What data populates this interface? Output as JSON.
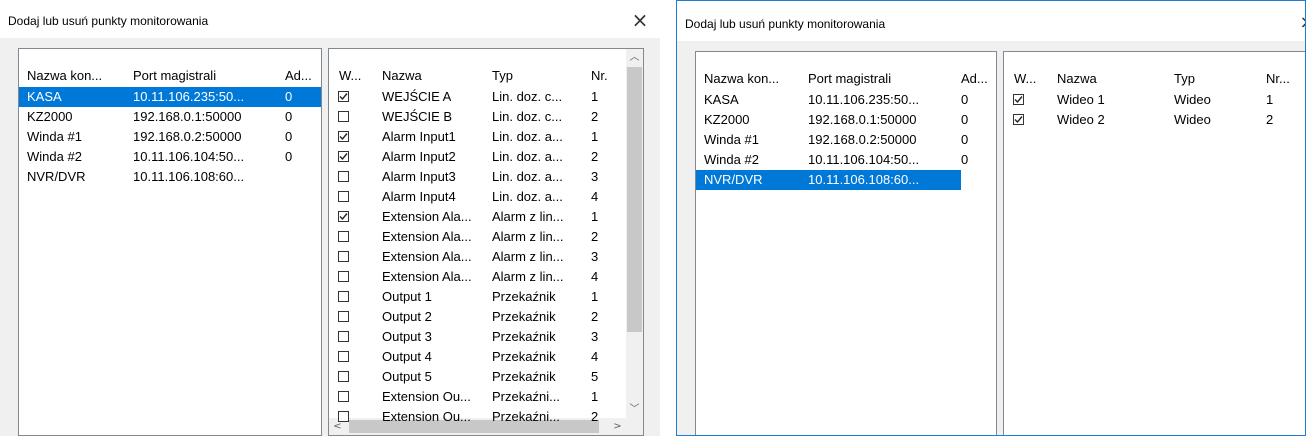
{
  "dialog_left": {
    "title": "Dodaj lub usuń punkty monitorowania",
    "close_icon": "×",
    "controllers": {
      "headers": [
        "Nazwa kon...",
        "Port magistrali",
        "Ad..."
      ],
      "rows": [
        {
          "name": "KASA",
          "port": "10.11.106.235:50...",
          "addr": "0",
          "selected": true
        },
        {
          "name": "KZ2000",
          "port": "192.168.0.1:50000",
          "addr": "0",
          "selected": false
        },
        {
          "name": "Winda #1",
          "port": "192.168.0.2:50000",
          "addr": "0",
          "selected": false
        },
        {
          "name": "Winda #2",
          "port": "10.11.106.104:50...",
          "addr": "0",
          "selected": false
        },
        {
          "name": "NVR/DVR",
          "port": "10.11.106.108:60...",
          "addr": "",
          "selected": false
        }
      ]
    },
    "points": {
      "headers": [
        "W...",
        "Nazwa",
        "Typ",
        "Nr."
      ],
      "rows": [
        {
          "checked": true,
          "name": "WEJŚCIE A",
          "type": "Lin. doz. c...",
          "nr": "1"
        },
        {
          "checked": false,
          "name": "WEJŚCIE B",
          "type": "Lin. doz. c...",
          "nr": "2"
        },
        {
          "checked": true,
          "name": "Alarm Input1",
          "type": "Lin. doz. a...",
          "nr": "1"
        },
        {
          "checked": true,
          "name": "Alarm Input2",
          "type": "Lin. doz. a...",
          "nr": "2"
        },
        {
          "checked": false,
          "name": "Alarm Input3",
          "type": "Lin. doz. a...",
          "nr": "3"
        },
        {
          "checked": false,
          "name": "Alarm Input4",
          "type": "Lin. doz. a...",
          "nr": "4"
        },
        {
          "checked": true,
          "name": "Extension Ala...",
          "type": "Alarm z lin...",
          "nr": "1"
        },
        {
          "checked": false,
          "name": "Extension Ala...",
          "type": "Alarm z lin...",
          "nr": "2"
        },
        {
          "checked": false,
          "name": "Extension Ala...",
          "type": "Alarm z lin...",
          "nr": "3"
        },
        {
          "checked": false,
          "name": "Extension Ala...",
          "type": "Alarm z lin...",
          "nr": "4"
        },
        {
          "checked": false,
          "name": "Output 1",
          "type": "Przekaźnik",
          "nr": "1"
        },
        {
          "checked": false,
          "name": "Output 2",
          "type": "Przekaźnik",
          "nr": "2"
        },
        {
          "checked": false,
          "name": "Output 3",
          "type": "Przekaźnik",
          "nr": "3"
        },
        {
          "checked": false,
          "name": "Output 4",
          "type": "Przekaźnik",
          "nr": "4"
        },
        {
          "checked": false,
          "name": "Output 5",
          "type": "Przekaźnik",
          "nr": "5"
        },
        {
          "checked": false,
          "name": "Extension Ou...",
          "type": "Przekaźni...",
          "nr": "1"
        },
        {
          "checked": false,
          "name": "Extension Ou...",
          "type": "Przekaźni...",
          "nr": "2"
        }
      ]
    }
  },
  "dialog_right": {
    "title": "Dodaj lub usuń punkty monitorowania",
    "close_icon": "×",
    "controllers": {
      "headers": [
        "Nazwa kon...",
        "Port magistrali",
        "Ad..."
      ],
      "rows": [
        {
          "name": "KASA",
          "port": "10.11.106.235:50...",
          "addr": "0",
          "selected": false
        },
        {
          "name": "KZ2000",
          "port": "192.168.0.1:50000",
          "addr": "0",
          "selected": false
        },
        {
          "name": "Winda #1",
          "port": "192.168.0.2:50000",
          "addr": "0",
          "selected": false
        },
        {
          "name": "Winda #2",
          "port": "10.11.106.104:50...",
          "addr": "0",
          "selected": false
        },
        {
          "name": "NVR/DVR",
          "port": "10.11.106.108:60...",
          "addr": "",
          "selected": true
        }
      ]
    },
    "points": {
      "headers": [
        "W...",
        "Nazwa",
        "Typ",
        "Nr..."
      ],
      "rows": [
        {
          "checked": true,
          "name": "Wideo 1",
          "type": "Wideo",
          "nr": "1"
        },
        {
          "checked": true,
          "name": "Wideo 2",
          "type": "Wideo",
          "nr": "2"
        }
      ]
    }
  },
  "colors": {
    "selection": "#0078d7",
    "dialog_border": "#1e7bd6",
    "client_bg": "#f0f0f0"
  }
}
